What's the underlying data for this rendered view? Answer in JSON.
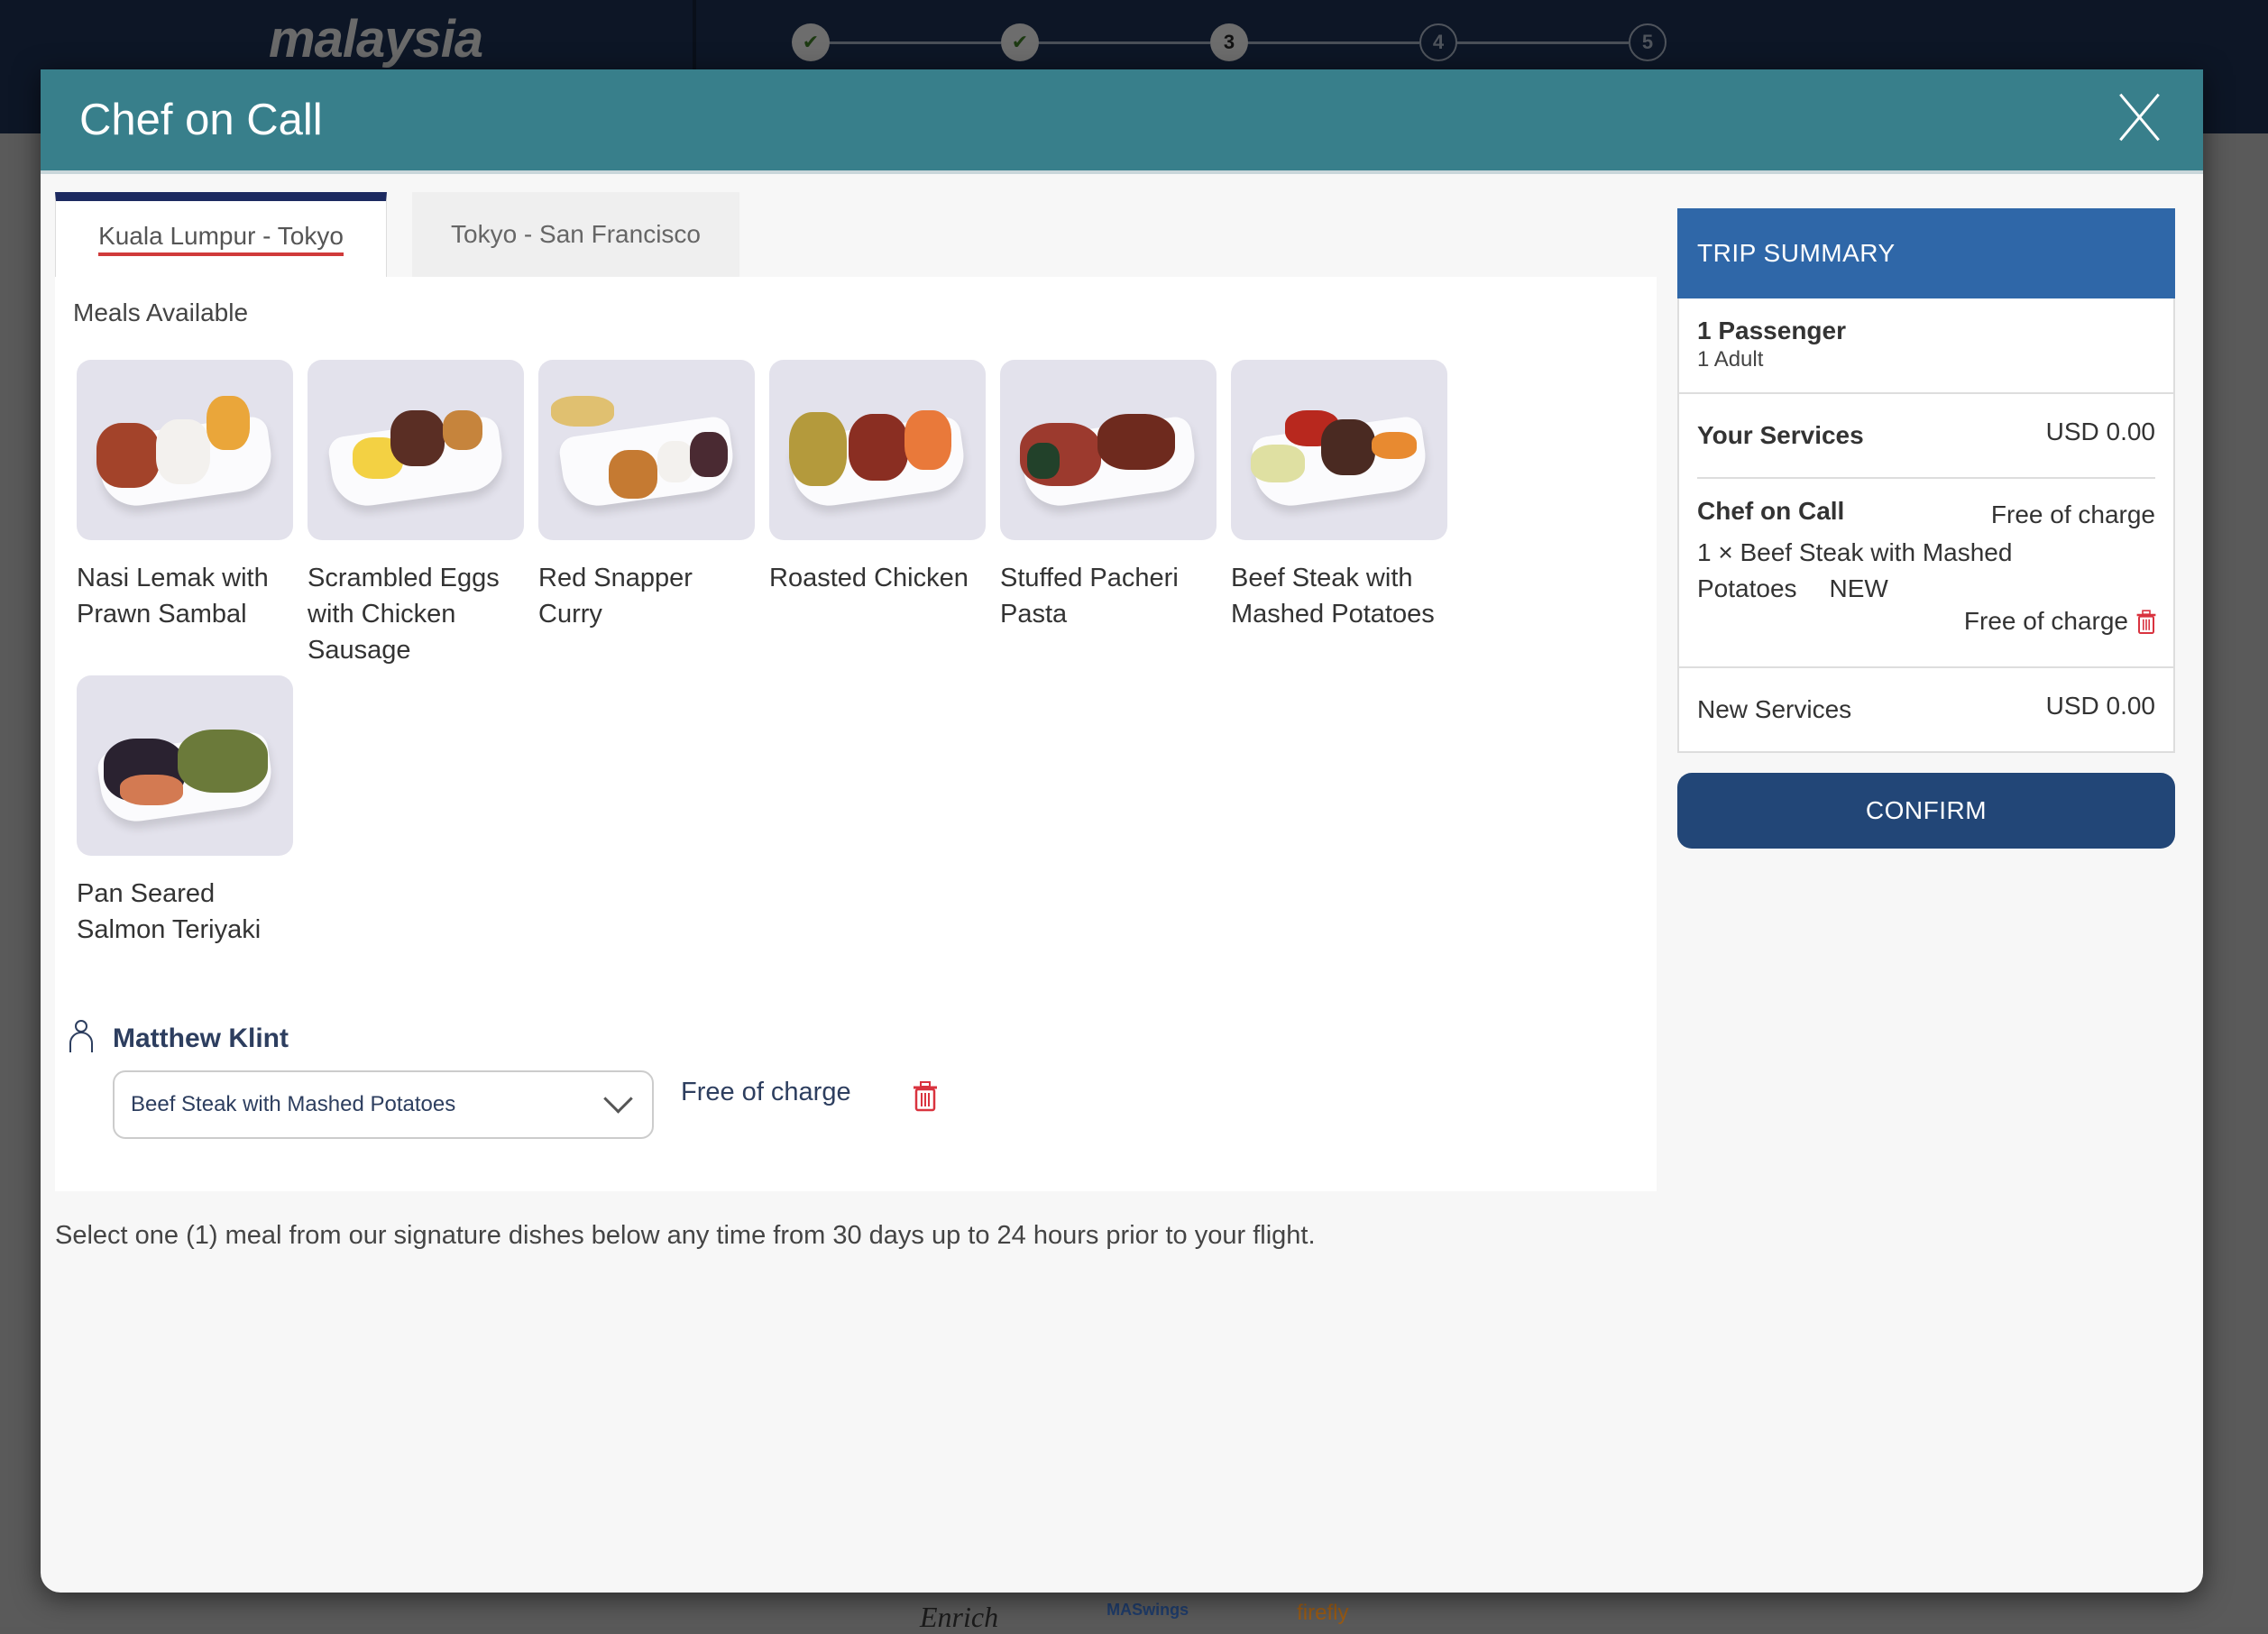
{
  "background": {
    "logo_text": "malaysia",
    "stepper": {
      "steps": [
        {
          "label": "✔",
          "state": "done"
        },
        {
          "label": "✔",
          "state": "done"
        },
        {
          "label": "3",
          "state": "current"
        },
        {
          "label": "4",
          "state": "todo"
        },
        {
          "label": "5",
          "state": "todo"
        }
      ]
    },
    "footer_logos": [
      "Enrich",
      "MASwings",
      "firefly"
    ]
  },
  "modal": {
    "title": "Chef on Call",
    "close_icon": "close-icon",
    "tabs": [
      {
        "label": "Kuala Lumpur - Tokyo",
        "active": true
      },
      {
        "label": "Tokyo - San Francisco",
        "active": false
      }
    ],
    "meals_title": "Meals Available",
    "meals": [
      {
        "name": "Nasi Lemak with Prawn Sambal"
      },
      {
        "name": "Scrambled Eggs with Chicken Sausage"
      },
      {
        "name": "Red Snapper Curry"
      },
      {
        "name": "Roasted Chicken"
      },
      {
        "name": "Stuffed Pacheri Pasta"
      },
      {
        "name": "Beef Steak with Mashed Potatoes"
      },
      {
        "name": "Pan Seared Salmon Teriyaki"
      }
    ],
    "passenger": {
      "name": "Matthew Klint",
      "selected_meal": "Beef Steak with Mashed Potatoes",
      "price": "Free of charge"
    },
    "note": "Select one (1) meal from our signature dishes below any time from 30 days up to 24 hours prior to your flight."
  },
  "summary": {
    "title": "TRIP SUMMARY",
    "passengers": "1 Passenger",
    "passenger_detail": "1 Adult",
    "your_services_label": "Your Services",
    "your_services_amount": "USD 0.00",
    "service_name": "Chef on Call",
    "service_price": "Free of charge",
    "item_line1": "1 × Beef Steak with Mashed",
    "item_line2": "Potatoes",
    "item_badge": "NEW",
    "item_price": "Free of charge",
    "new_services_label": "New Services",
    "new_services_amount": "USD 0.00",
    "confirm_label": "CONFIRM"
  },
  "colors": {
    "header": "#387f8b",
    "summary_header": "#2f67a8",
    "confirm": "#224677",
    "active_tab_bar": "#1c2a60",
    "tab_underline": "#d03a3a",
    "trash": "#d9333f"
  }
}
